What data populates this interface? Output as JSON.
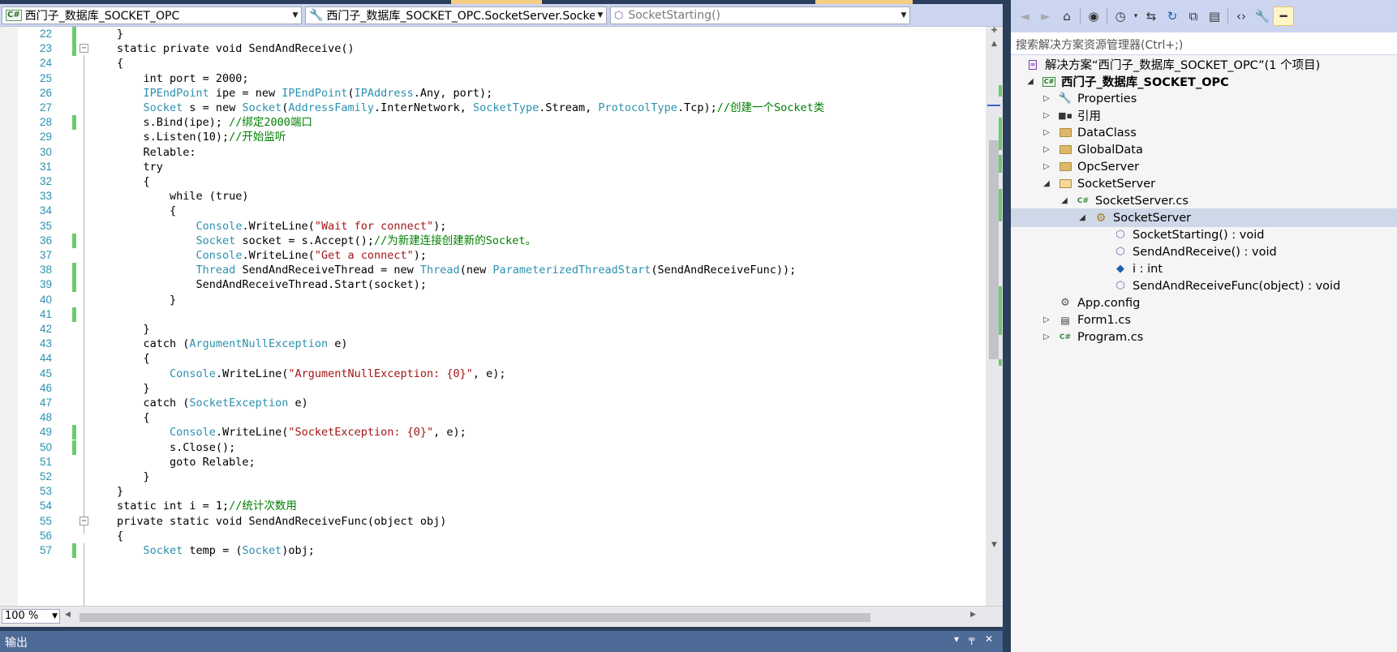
{
  "editor": {
    "nav_project": "西门子_数据库_SOCKET_OPC",
    "nav_class": "西门子_数据库_SOCKET_OPC.SocketServer.SocketS",
    "nav_member": "SocketStarting()",
    "project_icon": "C#",
    "zoom": "100 %",
    "lines": [
      {
        "num": "22",
        "changed": true,
        "fold": "",
        "parts": [
          {
            "t": "}",
            "c": ""
          }
        ]
      },
      {
        "num": "23",
        "changed": true,
        "fold": "minus",
        "parts": [
          {
            "t": "static private void SendAndReceive()",
            "c": ""
          }
        ]
      },
      {
        "num": "24",
        "changed": false,
        "fold": "",
        "parts": [
          {
            "t": "{",
            "c": ""
          }
        ]
      },
      {
        "num": "25",
        "changed": false,
        "fold": "",
        "parts": [
          {
            "t": "    int port = 2000;",
            "c": ""
          }
        ]
      },
      {
        "num": "26",
        "changed": false,
        "fold": "",
        "parts": [
          {
            "t": "    ",
            "c": ""
          },
          {
            "t": "IPEndPoint",
            "c": "ty"
          },
          {
            "t": " ipe = new ",
            "c": ""
          },
          {
            "t": "IPEndPoint",
            "c": "ty"
          },
          {
            "t": "(",
            "c": ""
          },
          {
            "t": "IPAddress",
            "c": "ty"
          },
          {
            "t": ".Any, port);",
            "c": ""
          }
        ]
      },
      {
        "num": "27",
        "changed": false,
        "fold": "",
        "parts": [
          {
            "t": "    ",
            "c": ""
          },
          {
            "t": "Socket",
            "c": "ty"
          },
          {
            "t": " s = new ",
            "c": ""
          },
          {
            "t": "Socket",
            "c": "ty"
          },
          {
            "t": "(",
            "c": ""
          },
          {
            "t": "AddressFamily",
            "c": "ty"
          },
          {
            "t": ".InterNetwork, ",
            "c": ""
          },
          {
            "t": "SocketType",
            "c": "ty"
          },
          {
            "t": ".Stream, ",
            "c": ""
          },
          {
            "t": "ProtocolType",
            "c": "ty"
          },
          {
            "t": ".Tcp);",
            "c": ""
          },
          {
            "t": "//创建一个Socket类",
            "c": "cm"
          }
        ]
      },
      {
        "num": "28",
        "changed": true,
        "fold": "",
        "parts": [
          {
            "t": "    s.Bind(ipe); ",
            "c": ""
          },
          {
            "t": "//绑定2000端口",
            "c": "cm"
          }
        ]
      },
      {
        "num": "29",
        "changed": false,
        "fold": "",
        "parts": [
          {
            "t": "    s.Listen(10);",
            "c": ""
          },
          {
            "t": "//开始监听",
            "c": "cm"
          }
        ]
      },
      {
        "num": "30",
        "changed": false,
        "fold": "",
        "parts": [
          {
            "t": "    Relable:",
            "c": ""
          }
        ]
      },
      {
        "num": "31",
        "changed": false,
        "fold": "",
        "parts": [
          {
            "t": "    try",
            "c": ""
          }
        ]
      },
      {
        "num": "32",
        "changed": false,
        "fold": "",
        "parts": [
          {
            "t": "    {",
            "c": ""
          }
        ]
      },
      {
        "num": "33",
        "changed": false,
        "fold": "",
        "parts": [
          {
            "t": "        while (true)",
            "c": ""
          }
        ]
      },
      {
        "num": "34",
        "changed": false,
        "fold": "",
        "parts": [
          {
            "t": "        {",
            "c": ""
          }
        ]
      },
      {
        "num": "35",
        "changed": false,
        "fold": "",
        "parts": [
          {
            "t": "            ",
            "c": ""
          },
          {
            "t": "Console",
            "c": "ty"
          },
          {
            "t": ".WriteLine(",
            "c": ""
          },
          {
            "t": "\"Wait for connect\"",
            "c": "str"
          },
          {
            "t": ");",
            "c": ""
          }
        ]
      },
      {
        "num": "36",
        "changed": true,
        "fold": "",
        "parts": [
          {
            "t": "            ",
            "c": ""
          },
          {
            "t": "Socket",
            "c": "ty"
          },
          {
            "t": " socket = s.Accept();",
            "c": ""
          },
          {
            "t": "//为新建连接创建新的Socket。",
            "c": "cm"
          }
        ]
      },
      {
        "num": "37",
        "changed": false,
        "fold": "",
        "parts": [
          {
            "t": "            ",
            "c": ""
          },
          {
            "t": "Console",
            "c": "ty"
          },
          {
            "t": ".WriteLine(",
            "c": ""
          },
          {
            "t": "\"Get a connect\"",
            "c": "str"
          },
          {
            "t": ");",
            "c": ""
          }
        ]
      },
      {
        "num": "38",
        "changed": true,
        "fold": "",
        "parts": [
          {
            "t": "            ",
            "c": ""
          },
          {
            "t": "Thread",
            "c": "ty"
          },
          {
            "t": " SendAndReceiveThread = new ",
            "c": ""
          },
          {
            "t": "Thread",
            "c": "ty"
          },
          {
            "t": "(new ",
            "c": ""
          },
          {
            "t": "ParameterizedThreadStart",
            "c": "ty"
          },
          {
            "t": "(SendAndReceiveFunc));",
            "c": ""
          }
        ]
      },
      {
        "num": "39",
        "changed": true,
        "fold": "",
        "parts": [
          {
            "t": "            SendAndReceiveThread.Start(socket);",
            "c": ""
          }
        ]
      },
      {
        "num": "40",
        "changed": false,
        "fold": "",
        "parts": [
          {
            "t": "        }",
            "c": ""
          }
        ]
      },
      {
        "num": "41",
        "changed": true,
        "fold": "",
        "parts": [
          {
            "t": "",
            "c": ""
          }
        ]
      },
      {
        "num": "42",
        "changed": false,
        "fold": "",
        "parts": [
          {
            "t": "    }",
            "c": ""
          }
        ]
      },
      {
        "num": "43",
        "changed": false,
        "fold": "",
        "parts": [
          {
            "t": "    catch (",
            "c": ""
          },
          {
            "t": "ArgumentNullException",
            "c": "ty"
          },
          {
            "t": " e)",
            "c": ""
          }
        ]
      },
      {
        "num": "44",
        "changed": false,
        "fold": "",
        "parts": [
          {
            "t": "    {",
            "c": ""
          }
        ]
      },
      {
        "num": "45",
        "changed": false,
        "fold": "",
        "parts": [
          {
            "t": "        ",
            "c": ""
          },
          {
            "t": "Console",
            "c": "ty"
          },
          {
            "t": ".WriteLine(",
            "c": ""
          },
          {
            "t": "\"ArgumentNullException: {0}\"",
            "c": "str"
          },
          {
            "t": ", e);",
            "c": ""
          }
        ]
      },
      {
        "num": "46",
        "changed": false,
        "fold": "",
        "parts": [
          {
            "t": "    }",
            "c": ""
          }
        ]
      },
      {
        "num": "47",
        "changed": false,
        "fold": "",
        "parts": [
          {
            "t": "    catch (",
            "c": ""
          },
          {
            "t": "SocketException",
            "c": "ty"
          },
          {
            "t": " e)",
            "c": ""
          }
        ]
      },
      {
        "num": "48",
        "changed": false,
        "fold": "",
        "parts": [
          {
            "t": "    {",
            "c": ""
          }
        ]
      },
      {
        "num": "49",
        "changed": true,
        "fold": "",
        "parts": [
          {
            "t": "        ",
            "c": ""
          },
          {
            "t": "Console",
            "c": "ty"
          },
          {
            "t": ".WriteLine(",
            "c": ""
          },
          {
            "t": "\"SocketException: {0}\"",
            "c": "str"
          },
          {
            "t": ", e);",
            "c": ""
          }
        ]
      },
      {
        "num": "50",
        "changed": true,
        "fold": "",
        "parts": [
          {
            "t": "        s.Close();",
            "c": ""
          }
        ]
      },
      {
        "num": "51",
        "changed": false,
        "fold": "",
        "parts": [
          {
            "t": "        goto Relable;",
            "c": ""
          }
        ]
      },
      {
        "num": "52",
        "changed": false,
        "fold": "",
        "parts": [
          {
            "t": "    }",
            "c": ""
          }
        ]
      },
      {
        "num": "53",
        "changed": false,
        "fold": "",
        "parts": [
          {
            "t": "}",
            "c": ""
          }
        ]
      },
      {
        "num": "54",
        "changed": false,
        "fold": "",
        "parts": [
          {
            "t": "static int i = 1;",
            "c": ""
          },
          {
            "t": "//统计次数用",
            "c": "cm"
          }
        ]
      },
      {
        "num": "55",
        "changed": false,
        "fold": "minus",
        "parts": [
          {
            "t": "private static void SendAndReceiveFunc(object obj)",
            "c": ""
          }
        ]
      },
      {
        "num": "56",
        "changed": false,
        "fold": "",
        "parts": [
          {
            "t": "{",
            "c": ""
          }
        ]
      },
      {
        "num": "57",
        "changed": true,
        "fold": "",
        "parts": [
          {
            "t": "    ",
            "c": ""
          },
          {
            "t": "Socket",
            "c": "ty"
          },
          {
            "t": " temp = (",
            "c": ""
          },
          {
            "t": "Socket",
            "c": "ty"
          },
          {
            "t": ")obj;",
            "c": ""
          }
        ]
      }
    ]
  },
  "output": {
    "title": "输出",
    "dropdown_glyph": "▾",
    "pin_glyph": "╤",
    "close_glyph": "✕"
  },
  "solution_explorer": {
    "search_placeholder": "搜索解决方案资源管理器(Ctrl+;)",
    "toolbar_icons": [
      "back-icon",
      "forward-icon",
      "home-icon",
      "vs-icon",
      "history-icon",
      "dropdown-icon",
      "sync-icon",
      "refresh-icon",
      "collapse-all-icon",
      "show-all-files-icon",
      "view-code-icon",
      "properties-icon",
      "pin-icon"
    ],
    "tree": [
      {
        "label": "解决方案“西门子_数据库_SOCKET_OPC”(1 个项目)",
        "level": 0,
        "expander": "",
        "icon": "solution-icon",
        "bold": false,
        "selected": false
      },
      {
        "label": "西门子_数据库_SOCKET_OPC",
        "level": 1,
        "expander": "open",
        "icon": "csproj-icon",
        "bold": true,
        "selected": false
      },
      {
        "label": "Properties",
        "level": 2,
        "expander": "closed",
        "icon": "wrench-icon",
        "bold": false,
        "selected": false
      },
      {
        "label": "引用",
        "level": 2,
        "expander": "closed",
        "icon": "references-icon",
        "bold": false,
        "selected": false
      },
      {
        "label": "DataClass",
        "level": 2,
        "expander": "closed",
        "icon": "folder-icon",
        "bold": false,
        "selected": false
      },
      {
        "label": "GlobalData",
        "level": 2,
        "expander": "closed",
        "icon": "folder-icon",
        "bold": false,
        "selected": false
      },
      {
        "label": "OpcServer",
        "level": 2,
        "expander": "closed",
        "icon": "folder-icon",
        "bold": false,
        "selected": false
      },
      {
        "label": "SocketServer",
        "level": 2,
        "expander": "open",
        "icon": "folder-open-icon",
        "bold": false,
        "selected": false
      },
      {
        "label": "SocketServer.cs",
        "level": 3,
        "expander": "open",
        "icon": "csharp-file-icon",
        "bold": false,
        "selected": false
      },
      {
        "label": "SocketServer",
        "level": 4,
        "expander": "open",
        "icon": "class-icon",
        "bold": false,
        "selected": true
      },
      {
        "label": "SocketStarting() : void",
        "level": 5,
        "expander": "",
        "icon": "method-private-icon",
        "bold": false,
        "selected": false
      },
      {
        "label": "SendAndReceive() : void",
        "level": 5,
        "expander": "",
        "icon": "method-private-icon",
        "bold": false,
        "selected": false
      },
      {
        "label": "i : int",
        "level": 5,
        "expander": "",
        "icon": "field-private-icon",
        "bold": false,
        "selected": false
      },
      {
        "label": "SendAndReceiveFunc(object) : void",
        "level": 5,
        "expander": "",
        "icon": "method-private-icon",
        "bold": false,
        "selected": false
      },
      {
        "label": "App.config",
        "level": 2,
        "expander": "",
        "icon": "config-icon",
        "bold": false,
        "selected": false
      },
      {
        "label": "Form1.cs",
        "level": 2,
        "expander": "closed",
        "icon": "form-icon",
        "bold": false,
        "selected": false
      },
      {
        "label": "Program.cs",
        "level": 2,
        "expander": "closed",
        "icon": "csharp-file-icon",
        "bold": false,
        "selected": false
      }
    ]
  },
  "colors": {
    "frame": "#2b3e5c",
    "type": "#2b91af",
    "string": "#a31515",
    "comment": "#008000",
    "change_bar": "#6ccb6c",
    "selection": "#cfd8e8",
    "output_header": "#4e6a96"
  }
}
